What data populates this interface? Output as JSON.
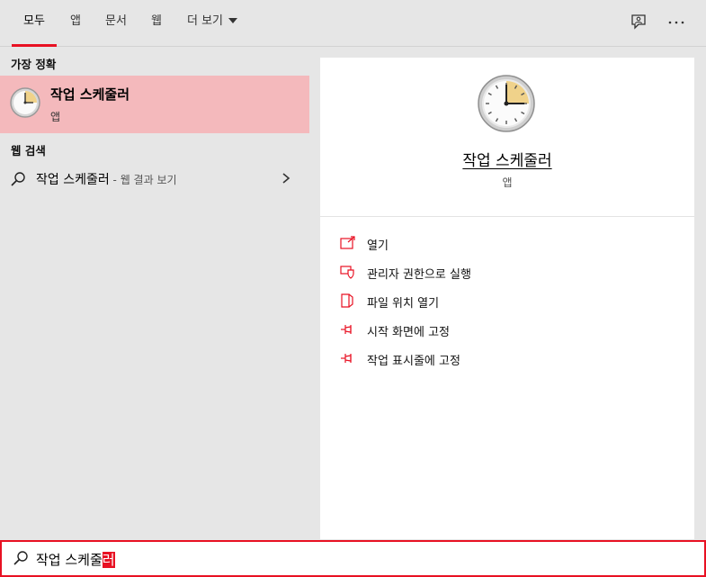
{
  "tabs": [
    {
      "label": "모두",
      "active": true
    },
    {
      "label": "앱"
    },
    {
      "label": "문서"
    },
    {
      "label": "웹"
    },
    {
      "label": "더 보기"
    }
  ],
  "top_icons": [
    "feedback-icon",
    "more-options-icon"
  ],
  "left": {
    "best_match_header": "가장 정확",
    "best_match": {
      "title": "작업 스케줄러",
      "subtitle": "앱",
      "icon": "clock-icon"
    },
    "web_header": "웹 검색",
    "web_result": {
      "query": "작업 스케줄러",
      "hint": " - 웹 결과 보기"
    }
  },
  "right": {
    "title": "작업 스케줄러",
    "subtitle": "앱",
    "actions": [
      {
        "label": "열기",
        "icon": "open-icon"
      },
      {
        "label": "관리자 권한으로 실행",
        "icon": "admin-shield-icon"
      },
      {
        "label": "파일 위치 열기",
        "icon": "file-location-icon"
      },
      {
        "label": "시작 화면에 고정",
        "icon": "pin-icon"
      },
      {
        "label": "작업 표시줄에 고정",
        "icon": "pin-icon"
      }
    ]
  },
  "search": {
    "typed": "작업 스케줄",
    "selected": "러"
  },
  "colors": {
    "accent": "#e81123",
    "highlight": "#f4b9bc",
    "panel": "#e6e6e6"
  }
}
